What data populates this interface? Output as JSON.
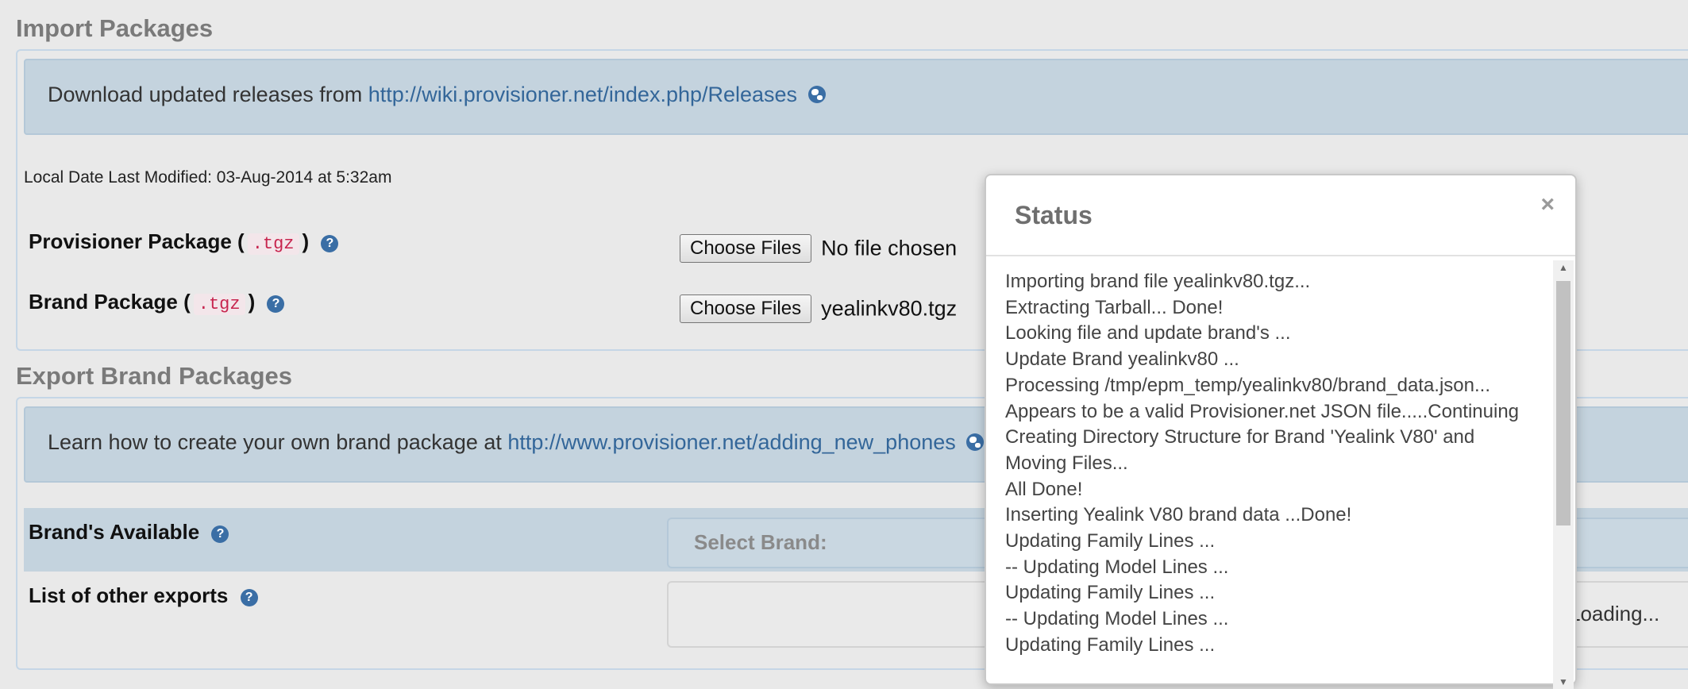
{
  "import_section": {
    "title": "Import Packages",
    "info_prefix": "Download updated releases from",
    "info_link": "http://wiki.provisioner.net/index.php/Releases",
    "local_date": "Local Date Last Modified: 03-Aug-2014 at 5:32am",
    "provisioner_label_pre": "Provisioner Package (",
    "provisioner_code": ".tgz",
    "provisioner_label_post": ")",
    "provisioner_button": "Choose Files",
    "provisioner_status": "No file chosen",
    "brand_label_pre": "Brand Package (",
    "brand_code": ".tgz",
    "brand_label_post": ")",
    "brand_button": "Choose Files",
    "brand_status": "yealinkv80.tgz"
  },
  "export_section": {
    "title": "Export Brand Packages",
    "info_prefix": "Learn how to create your own brand package at",
    "info_link": "http://www.provisioner.net/adding_new_phones",
    "brands_label": "Brand's Available",
    "select_placeholder": "Select Brand:",
    "other_exports_label": "List of other exports",
    "loading_text": "Loading..."
  },
  "status_dialog": {
    "title": "Status",
    "close": "×",
    "log": [
      "Importing brand file yealinkv80.tgz...",
      "Extracting Tarball... Done!",
      "Looking file and update brand's ...",
      "Update Brand yealinkv80 ...",
      "Processing /tmp/epm_temp/yealinkv80/brand_data.json...",
      "Appears to be a valid Provisioner.net JSON file.....Continuing",
      "Creating Directory Structure for Brand 'Yealink V80' and Moving Files...",
      "All Done!",
      "Inserting Yealink V80 brand data ...Done!",
      "Updating Family Lines ...",
      "-- Updating Model Lines ...",
      "Updating Family Lines ...",
      "-- Updating Model Lines ...",
      "Updating Family Lines ..."
    ]
  },
  "icons": {
    "globe": "globe-icon",
    "help": "help-circle-icon",
    "close": "close-icon"
  },
  "colors": {
    "info_bg": "#c4d3de",
    "link": "#336699",
    "code": "#c7254e"
  }
}
